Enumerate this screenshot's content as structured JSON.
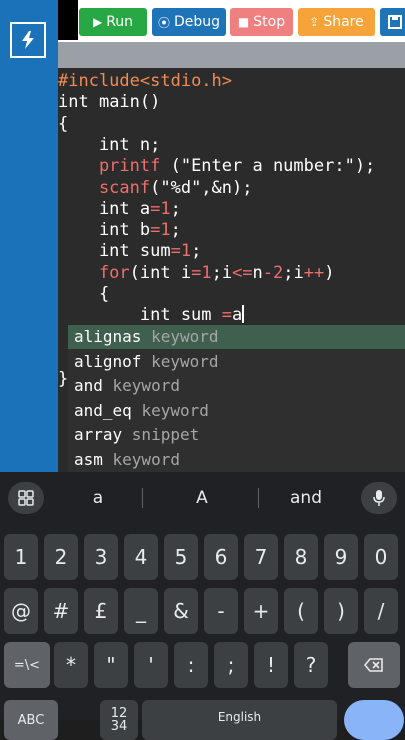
{
  "toolbar": {
    "run_label": "Run",
    "debug_label": "Debug",
    "stop_label": "Stop",
    "share_label": "Share"
  },
  "code_lines": [
    [
      {
        "t": "#include",
        "c": "tok-pre"
      },
      {
        "t": "<stdio.h>",
        "c": "tok-pre"
      }
    ],
    [
      {
        "t": "int",
        "c": "tok-kw"
      },
      {
        "t": " main()",
        "c": "tok-kw"
      }
    ],
    [
      {
        "t": "{",
        "c": "tok-kw"
      }
    ],
    [
      {
        "t": "    int",
        "c": "tok-kw"
      },
      {
        "t": " n;",
        "c": "tok-kw"
      }
    ],
    [
      {
        "t": "    printf",
        "c": "tok-fn"
      },
      {
        "t": " (\"Enter a number:\");",
        "c": "tok-str"
      }
    ],
    [
      {
        "t": "    scanf",
        "c": "tok-fn"
      },
      {
        "t": "(\"%d\",&n);",
        "c": "tok-str"
      }
    ],
    [
      {
        "t": "    int a",
        "c": "tok-kw"
      },
      {
        "t": "=",
        "c": "tok-op"
      },
      {
        "t": "1",
        "c": "tok-num"
      },
      {
        "t": ";",
        "c": "tok-kw"
      }
    ],
    [
      {
        "t": "    int b",
        "c": "tok-kw"
      },
      {
        "t": "=",
        "c": "tok-op"
      },
      {
        "t": "1",
        "c": "tok-num"
      },
      {
        "t": ";",
        "c": "tok-kw"
      }
    ],
    [
      {
        "t": "    int sum",
        "c": "tok-kw"
      },
      {
        "t": "=",
        "c": "tok-op"
      },
      {
        "t": "1",
        "c": "tok-num"
      },
      {
        "t": ";",
        "c": "tok-kw"
      }
    ],
    [
      {
        "t": "    for",
        "c": "tok-fn"
      },
      {
        "t": "(int i",
        "c": "tok-kw"
      },
      {
        "t": "=",
        "c": "tok-op"
      },
      {
        "t": "1",
        "c": "tok-num"
      },
      {
        "t": ";i",
        "c": "tok-kw"
      },
      {
        "t": "<=",
        "c": "tok-op"
      },
      {
        "t": "n",
        "c": "tok-kw"
      },
      {
        "t": "-",
        "c": "tok-op"
      },
      {
        "t": "2",
        "c": "tok-num"
      },
      {
        "t": ";i",
        "c": "tok-kw"
      },
      {
        "t": "++",
        "c": "tok-op"
      },
      {
        "t": ")",
        "c": "tok-kw"
      }
    ],
    [
      {
        "t": "    {",
        "c": "tok-kw"
      }
    ],
    [
      {
        "t": "        int sum ",
        "c": "tok-kw"
      },
      {
        "t": "=",
        "c": "tok-op"
      },
      {
        "t": "a",
        "c": "tok-kw"
      }
    ],
    [],
    [],
    [
      {
        "t": "}",
        "c": "tok-kw"
      }
    ]
  ],
  "autocomplete": [
    {
      "name": "alignas",
      "type": "keyword",
      "selected": true
    },
    {
      "name": "alignof",
      "type": "keyword",
      "selected": false
    },
    {
      "name": "and",
      "type": "keyword",
      "selected": false
    },
    {
      "name": "and_eq",
      "type": "keyword",
      "selected": false
    },
    {
      "name": "array",
      "type": "snippet",
      "selected": false
    },
    {
      "name": "asm",
      "type": "keyword",
      "selected": false
    }
  ],
  "keyboard": {
    "suggestions": [
      "a",
      "A",
      "and"
    ],
    "row1": [
      "1",
      "2",
      "3",
      "4",
      "5",
      "6",
      "7",
      "8",
      "9",
      "0"
    ],
    "row2": [
      "@",
      "#",
      "£",
      "_",
      "&",
      "-",
      "+",
      "(",
      ")",
      "/"
    ],
    "row3": [
      "=\\<",
      "*",
      "\"",
      "'",
      ":",
      ";",
      "!",
      "?"
    ],
    "row4_left": "ABC",
    "row4_mid": "12\n34",
    "space_label": "English"
  },
  "colors": {
    "sidebar": "#1a73b8",
    "editor_bg": "#2b2b2b",
    "keyword": "#ffffff",
    "preprocessor": "#f28b54",
    "function": "#ef6e6e",
    "autocomplete_selected": "#3f5f4f",
    "run_button": "#28a745",
    "debug_button": "#1f73b7",
    "stop_button": "#f08080",
    "share_button": "#f6a33a"
  },
  "icons": {
    "logo": "lightning-icon",
    "run": "play-icon",
    "debug": "debug-circle-icon",
    "stop": "stop-square-icon",
    "share": "share-icon",
    "save": "save-icon",
    "grid": "grid-icon",
    "mic": "microphone-icon",
    "backspace": "backspace-icon"
  }
}
